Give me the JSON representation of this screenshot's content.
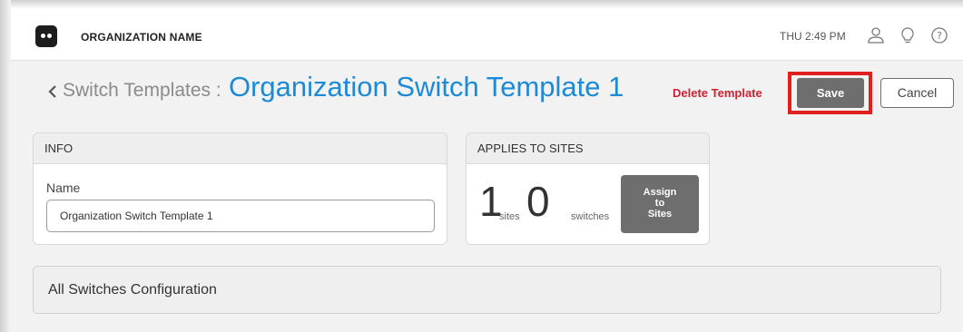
{
  "header": {
    "org_name": "ORGANIZATION NAME",
    "time": "THU 2:49 PM",
    "icons": [
      "account-icon",
      "lightbulb-icon",
      "help-icon"
    ]
  },
  "title_row": {
    "breadcrumb": "Switch Templates :",
    "title": "Organization Switch Template 1",
    "delete_label": "Delete Template",
    "save_label": "Save",
    "cancel_label": "Cancel"
  },
  "info": {
    "heading": "INFO",
    "name_label": "Name",
    "name_value": "Organization Switch Template 1"
  },
  "applies": {
    "heading": "APPLIES TO SITES",
    "sites_count": "1",
    "sites_label": "sites",
    "switches_count": "0",
    "switches_label": "switches",
    "assign_line1": "Assign",
    "assign_line2": "to",
    "assign_line3": "Sites"
  },
  "config": {
    "title": "All Switches Configuration"
  },
  "colors": {
    "accent": "#1d8ad6",
    "danger": "#cc2233",
    "button": "#6e6e6e",
    "highlight": "#e02020"
  }
}
